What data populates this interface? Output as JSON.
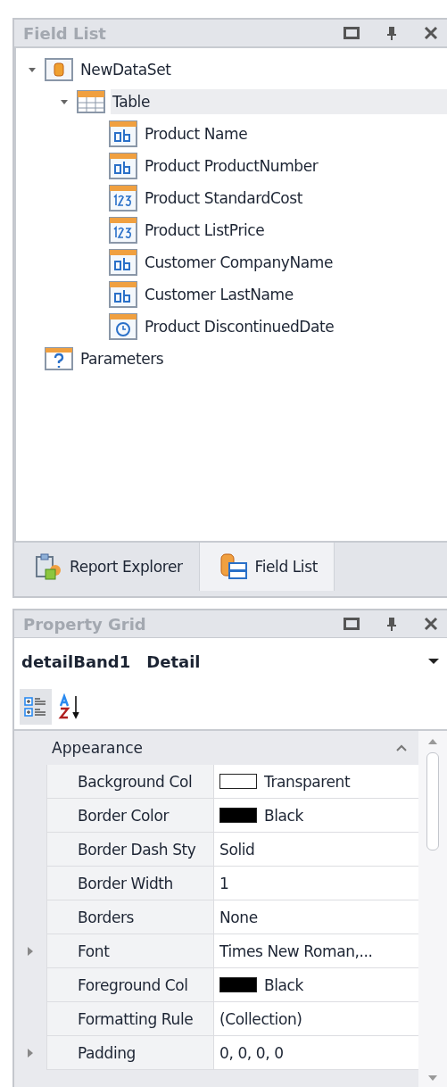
{
  "field_list": {
    "title": "Field List",
    "tree": [
      {
        "label": "NewDataSet",
        "kind": "dataset",
        "expanded": true,
        "selected": false,
        "children": [
          {
            "label": "Table",
            "kind": "table",
            "expanded": true,
            "selected": true,
            "children": [
              {
                "label": "Product Name",
                "kind": "text",
                "selected": false
              },
              {
                "label": "Product ProductNumber",
                "kind": "text",
                "selected": false
              },
              {
                "label": "Product StandardCost",
                "kind": "number",
                "selected": false
              },
              {
                "label": "Product ListPrice",
                "kind": "number",
                "selected": false
              },
              {
                "label": "Customer CompanyName",
                "kind": "text",
                "selected": false
              },
              {
                "label": "Customer LastName",
                "kind": "text",
                "selected": false
              },
              {
                "label": "Product DiscontinuedDate",
                "kind": "date",
                "selected": false
              }
            ]
          }
        ]
      },
      {
        "label": "Parameters",
        "kind": "parameters",
        "selected": false
      }
    ],
    "tabs": [
      {
        "label": "Report Explorer",
        "kind": "explorer",
        "selected": false
      },
      {
        "label": "Field List",
        "kind": "fields",
        "selected": true
      }
    ]
  },
  "property_grid": {
    "title": "Property Grid",
    "object": {
      "name": "detailBand1",
      "type": "Detail"
    },
    "toolbar": [
      {
        "kind": "categorized",
        "selected": true
      },
      {
        "kind": "alphabetical",
        "selected": false
      }
    ],
    "category": {
      "label": "Appearance",
      "expanded": true
    },
    "rows": [
      {
        "name": "Background Col",
        "value": "Transparent",
        "color": "#ffffff",
        "expandable": false
      },
      {
        "name": "Border Color",
        "value": "Black",
        "color": "#000000",
        "expandable": false
      },
      {
        "name": "Border Dash Sty",
        "value": "Solid",
        "expandable": false
      },
      {
        "name": "Border Width",
        "value": "1",
        "expandable": false
      },
      {
        "name": "Borders",
        "value": "None",
        "expandable": false
      },
      {
        "name": "Font",
        "value": "Times New Roman,...",
        "expandable": true
      },
      {
        "name": "Foreground Col",
        "value": "Black",
        "color": "#000000",
        "expandable": false
      },
      {
        "name": "Formatting Rule",
        "value": "(Collection)",
        "expandable": false
      },
      {
        "name": "Padding",
        "value": "0, 0, 0, 0",
        "expandable": true
      }
    ]
  }
}
